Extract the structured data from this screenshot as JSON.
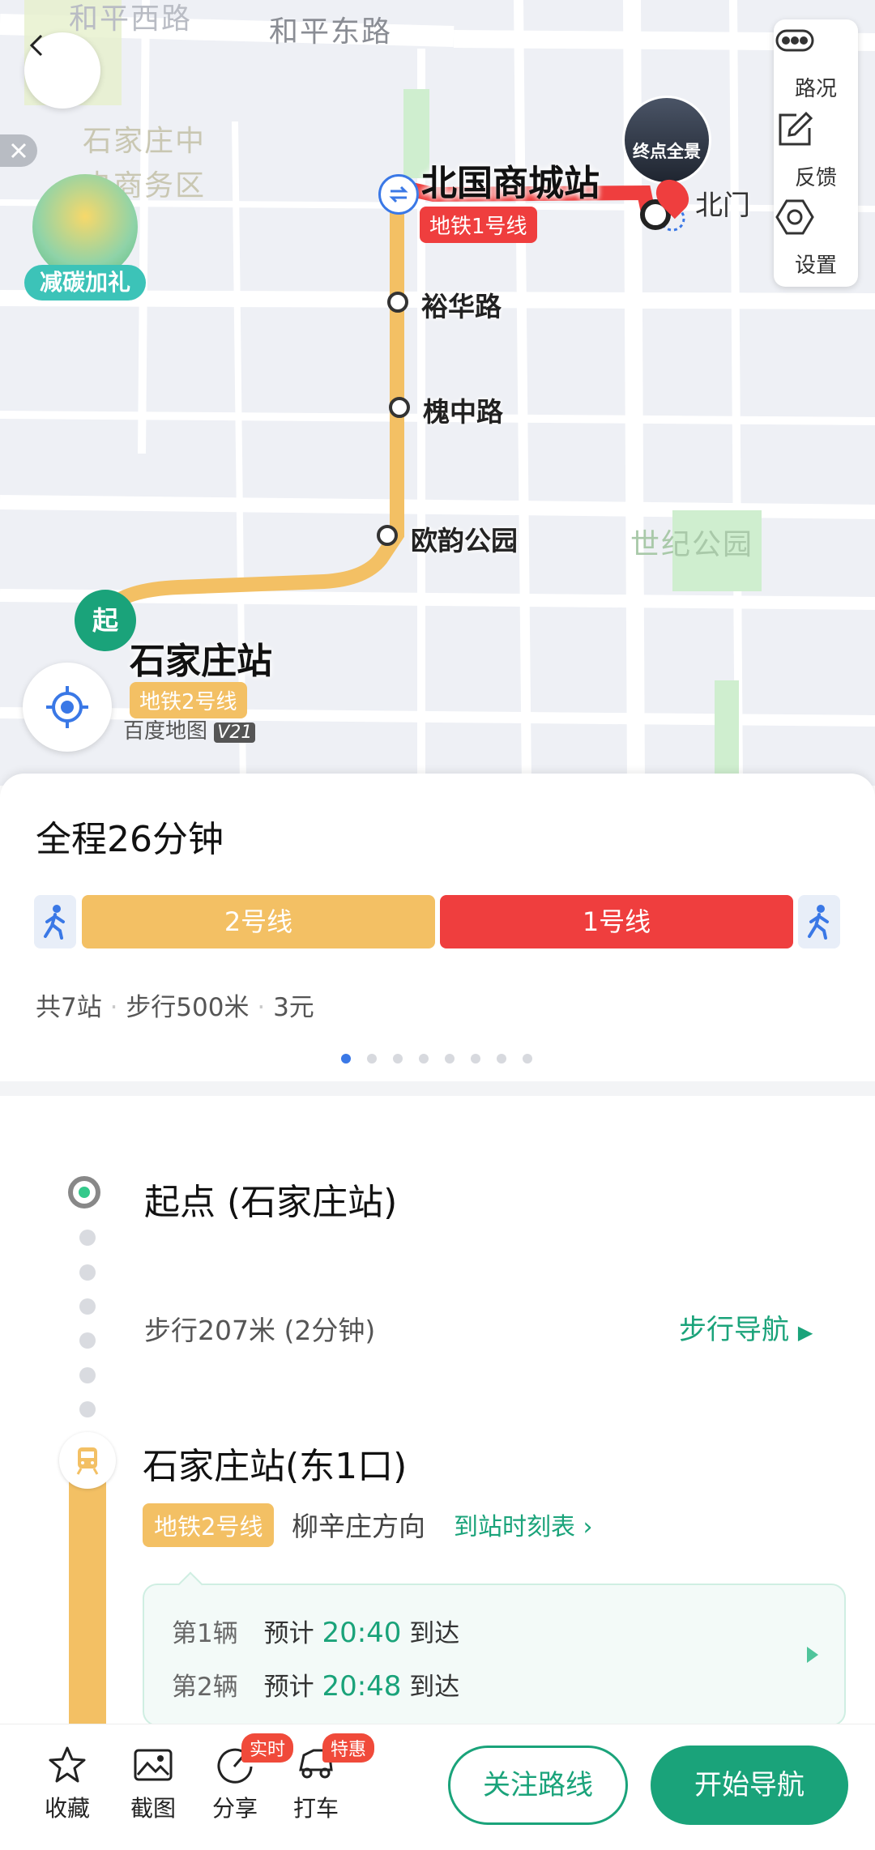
{
  "map": {
    "road_labels": [
      "和平西路",
      "和平东路"
    ],
    "area_labels": [
      "石家庄中",
      "央商务区",
      "世纪公园"
    ],
    "promo_label": "减碳加礼",
    "end_preview_label": "终点全景",
    "end_gate_label": "北门",
    "start_marker_label": "起",
    "start_station": "石家庄站",
    "start_line_tag": "地铁2号线",
    "end_station": "北国商城站",
    "end_line_tag": "地铁1号线",
    "stops": [
      "裕华路",
      "槐中路",
      "欧韵公园"
    ],
    "brand": "百度地图",
    "brand_version": "V21"
  },
  "right_panel": {
    "traffic_label": "路况",
    "feedback_label": "反馈",
    "settings_label": "设置"
  },
  "summary": {
    "duration": "全程26分钟",
    "segments": [
      {
        "label": "2号线",
        "color": "#f3c064"
      },
      {
        "label": "1号线",
        "color": "#ef3e3e"
      }
    ],
    "info_stations": "共7站",
    "info_walk": "步行500米",
    "info_fare": "3元",
    "page_dots_total": 8,
    "page_dots_active": 1
  },
  "details": {
    "start_label": "起点 (石家庄站)",
    "walk_text": "步行207米 (2分钟)",
    "walk_nav_label": "步行导航",
    "station_label": "石家庄站(东1口)",
    "line_tag": "地铁2号线",
    "direction": "柳辛庄方向",
    "timetable_label": "到站时刻表",
    "arrivals": [
      {
        "index": "第1辆",
        "prefix": "预计",
        "time": "20:40",
        "suffix": "到达"
      },
      {
        "index": "第2辆",
        "prefix": "预计",
        "time": "20:48",
        "suffix": "到达"
      }
    ]
  },
  "bottom_bar": {
    "favorite_label": "收藏",
    "screenshot_label": "截图",
    "share_label": "分享",
    "share_badge": "实时",
    "taxi_label": "打车",
    "taxi_badge": "特惠",
    "follow_label": "关注路线",
    "start_nav_label": "开始导航"
  },
  "colors": {
    "accent_green": "#1aa37a",
    "line2": "#f3c064",
    "line1": "#ef3e3e",
    "walk_blue": "#3a78e6"
  }
}
